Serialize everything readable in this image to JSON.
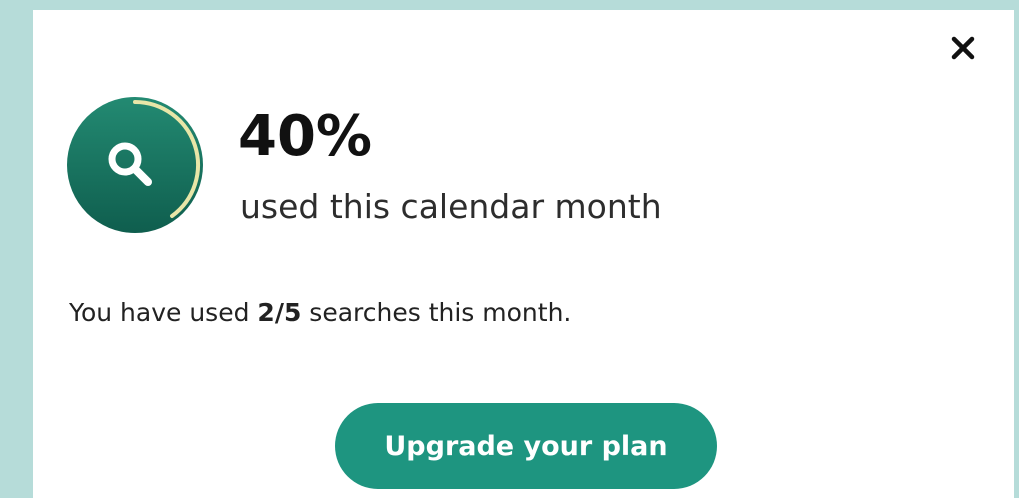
{
  "dialog": {
    "close_icon": "close-icon",
    "usage": {
      "percent_label": "40%",
      "percent_value": 40,
      "caption": "used this calendar month",
      "icon": "search-icon",
      "colors": {
        "ring_start": "#238a72",
        "ring_end": "#0f5e4e",
        "progress_arc": "#e8e6a8",
        "accent": "#1e9580"
      }
    },
    "summary": {
      "prefix": "You have used ",
      "used": "2",
      "separator": "/",
      "total": "5",
      "suffix": " searches this month."
    },
    "upgrade_button_label": "Upgrade your plan"
  }
}
